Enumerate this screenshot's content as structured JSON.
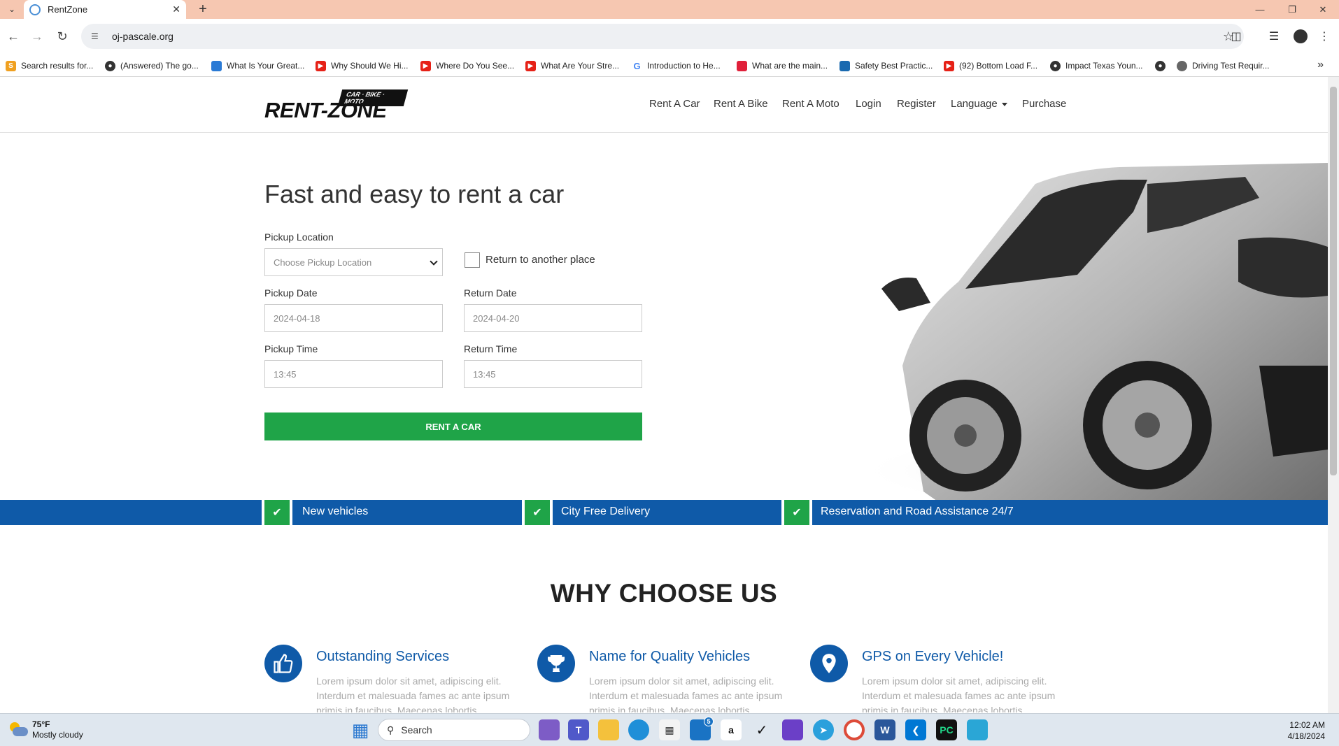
{
  "browser": {
    "tab_title": "RentZone",
    "url": "oj-pascale.org",
    "bookmarks": [
      {
        "label": "Search results for...",
        "icon": "s-badge-icon",
        "color": "#f0a020"
      },
      {
        "label": "(Answered) The go...",
        "icon": "globe-icon",
        "color": "#333333"
      },
      {
        "label": "What Is Your Great...",
        "icon": "tag-icon",
        "color": "#2a7ad5"
      },
      {
        "label": "Why Should We Hi...",
        "icon": "youtube-icon",
        "color": "#e62117"
      },
      {
        "label": "Where Do You See...",
        "icon": "youtube-icon",
        "color": "#e62117"
      },
      {
        "label": "What Are Your Stre...",
        "icon": "youtube-icon",
        "color": "#e62117"
      },
      {
        "label": "Introduction to He...",
        "icon": "google-icon",
        "color": "#4285f4"
      },
      {
        "label": "What are the main...",
        "icon": "tag-icon",
        "color": "#e0203a"
      },
      {
        "label": "Safety Best Practic...",
        "icon": "dmv-icon",
        "color": "#1a6ab0"
      },
      {
        "label": "(92) Bottom Load F...",
        "icon": "youtube-icon",
        "color": "#e62117"
      },
      {
        "label": "Impact Texas Youn...",
        "icon": "globe-icon",
        "color": "#333333"
      },
      {
        "label": "",
        "icon": "globe-icon",
        "color": "#333333"
      },
      {
        "label": "Driving Test Requir...",
        "icon": "seal-icon",
        "color": "#666666"
      }
    ]
  },
  "site": {
    "logo_tag": "CAR · BIKE · MOTO",
    "logo_word": "RENT-ZONE",
    "nav": {
      "rent_car": "Rent A Car",
      "rent_bike": "Rent A Bike",
      "rent_moto": "Rent A Moto",
      "login": "Login",
      "register": "Register",
      "language": "Language",
      "purchase": "Purchase"
    },
    "accent_blue": "#0f5aa8",
    "accent_green": "#1fa448"
  },
  "hero": {
    "title": "Fast and easy to rent a car",
    "pickup_location_label": "Pickup Location",
    "pickup_location_value": "Choose Pickup Location",
    "return_other_label": "Return to another place",
    "return_other_checked": false,
    "pickup_date_label": "Pickup Date",
    "pickup_date_value": "2024-04-18",
    "return_date_label": "Return Date",
    "return_date_value": "2024-04-20",
    "pickup_time_label": "Pickup Time",
    "pickup_time_value": "13:45",
    "return_time_label": "Return Time",
    "return_time_value": "13:45",
    "submit_label": "RENT A CAR"
  },
  "features": [
    "New vehicles",
    "City Free Delivery",
    "Reservation and Road Assistance 24/7"
  ],
  "why": {
    "title": "WHY CHOOSE US",
    "items": [
      {
        "icon": "thumbs-up-icon",
        "heading": "Outstanding Services",
        "text": "Lorem ipsum dolor sit amet, adipiscing elit. Interdum et malesuada fames ac ante ipsum primis in faucibus. Maecenas lobortis"
      },
      {
        "icon": "trophy-icon",
        "heading": "Name for Quality Vehicles",
        "text": "Lorem ipsum dolor sit amet, adipiscing elit. Interdum et malesuada fames ac ante ipsum primis in faucibus. Maecenas lobortis"
      },
      {
        "icon": "map-pin-icon",
        "heading": "GPS on Every Vehicle!",
        "text": "Lorem ipsum dolor sit amet, adipiscing elit. Interdum et malesuada fames ac ante ipsum primis in faucibus. Maecenas lobortis"
      }
    ]
  },
  "taskbar": {
    "temperature": "75°F",
    "weather": "Mostly cloudy",
    "search_placeholder": "Search",
    "time": "12:02 AM",
    "date": "4/18/2024",
    "mail_badge": "5"
  }
}
